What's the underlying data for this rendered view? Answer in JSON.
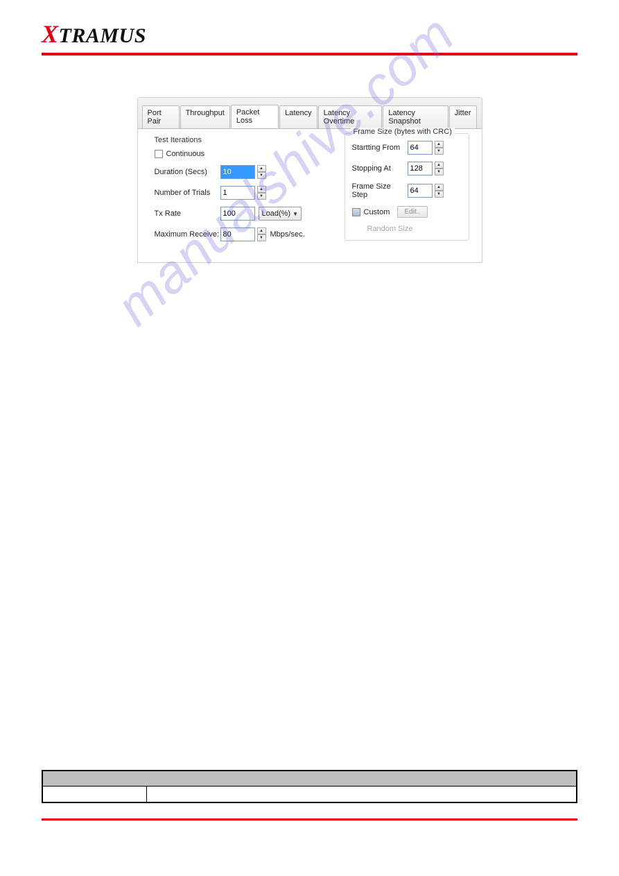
{
  "brand": {
    "prefix": "X",
    "rest": "TRAMUS"
  },
  "watermark": "manualshive.com",
  "tabs": [
    {
      "label": "Port Pair"
    },
    {
      "label": "Throughput"
    },
    {
      "label": "Packet Loss",
      "active": true
    },
    {
      "label": "Latency"
    },
    {
      "label": "Latency Overtime"
    },
    {
      "label": "Latency Snapshot"
    },
    {
      "label": "Jitter"
    }
  ],
  "left": {
    "title": "Test Iterations",
    "continuous": "Continuous",
    "duration_label": "Duration (Secs)",
    "duration_value": "10",
    "trials_label": "Number of Trials",
    "trials_value": "1",
    "txrate_label": "Tx Rate",
    "txrate_value": "100",
    "txrate_unit": "Load(%)",
    "maxrecv_label": "Maximum Receive:",
    "maxrecv_value": "80",
    "maxrecv_unit": "Mbps/sec."
  },
  "right": {
    "title": "Frame Size (bytes with CRC)",
    "start_label": "Startting From",
    "start_value": "64",
    "stop_label": "Stopping At",
    "stop_value": "128",
    "step_label": "Frame Size Step",
    "step_value": "64",
    "custom_label": "Custom",
    "edit_label": "Edit..",
    "random_label": "Random Size"
  }
}
